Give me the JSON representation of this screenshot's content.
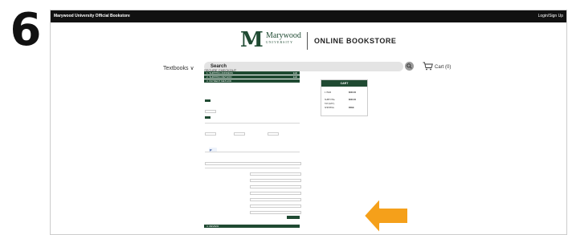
{
  "step_number": "6",
  "topbar": {
    "store_name": "Marywood University Official Bookstore",
    "login": "Login/Sign Up"
  },
  "logo": {
    "letter": "M",
    "name": "Marywood",
    "sub": "UNIVERSITY"
  },
  "header": {
    "title": "ONLINE BOOKSTORE",
    "menu_label": "Textbooks",
    "menu_caret": "∨",
    "search_label": "Search",
    "cart_label": "Cart (0)"
  },
  "checkout": {
    "title": "SECURE CHECKOUT",
    "steps": [
      {
        "label": "1. SHIPPING ADDRESS",
        "edit": "Edit"
      },
      {
        "label": "2. SHIPPING METHOD",
        "edit": "Edit"
      },
      {
        "label": "3. PAYMENT METHOD",
        "edit": ""
      }
    ],
    "review_label": "4. REVIEW"
  },
  "cart": {
    "title": "CART",
    "rows": [
      {
        "label": "1 ITEM",
        "value": "$000.00"
      },
      {
        "label": "SUBTOTAL",
        "value": "$000.00"
      },
      {
        "label": "TAX (EST.)",
        "value": ""
      },
      {
        "label": "SHIPPING",
        "value": "FREE"
      }
    ]
  },
  "colors": {
    "brand_green": "#1f4a32",
    "arrow_orange": "#f5a01a"
  }
}
